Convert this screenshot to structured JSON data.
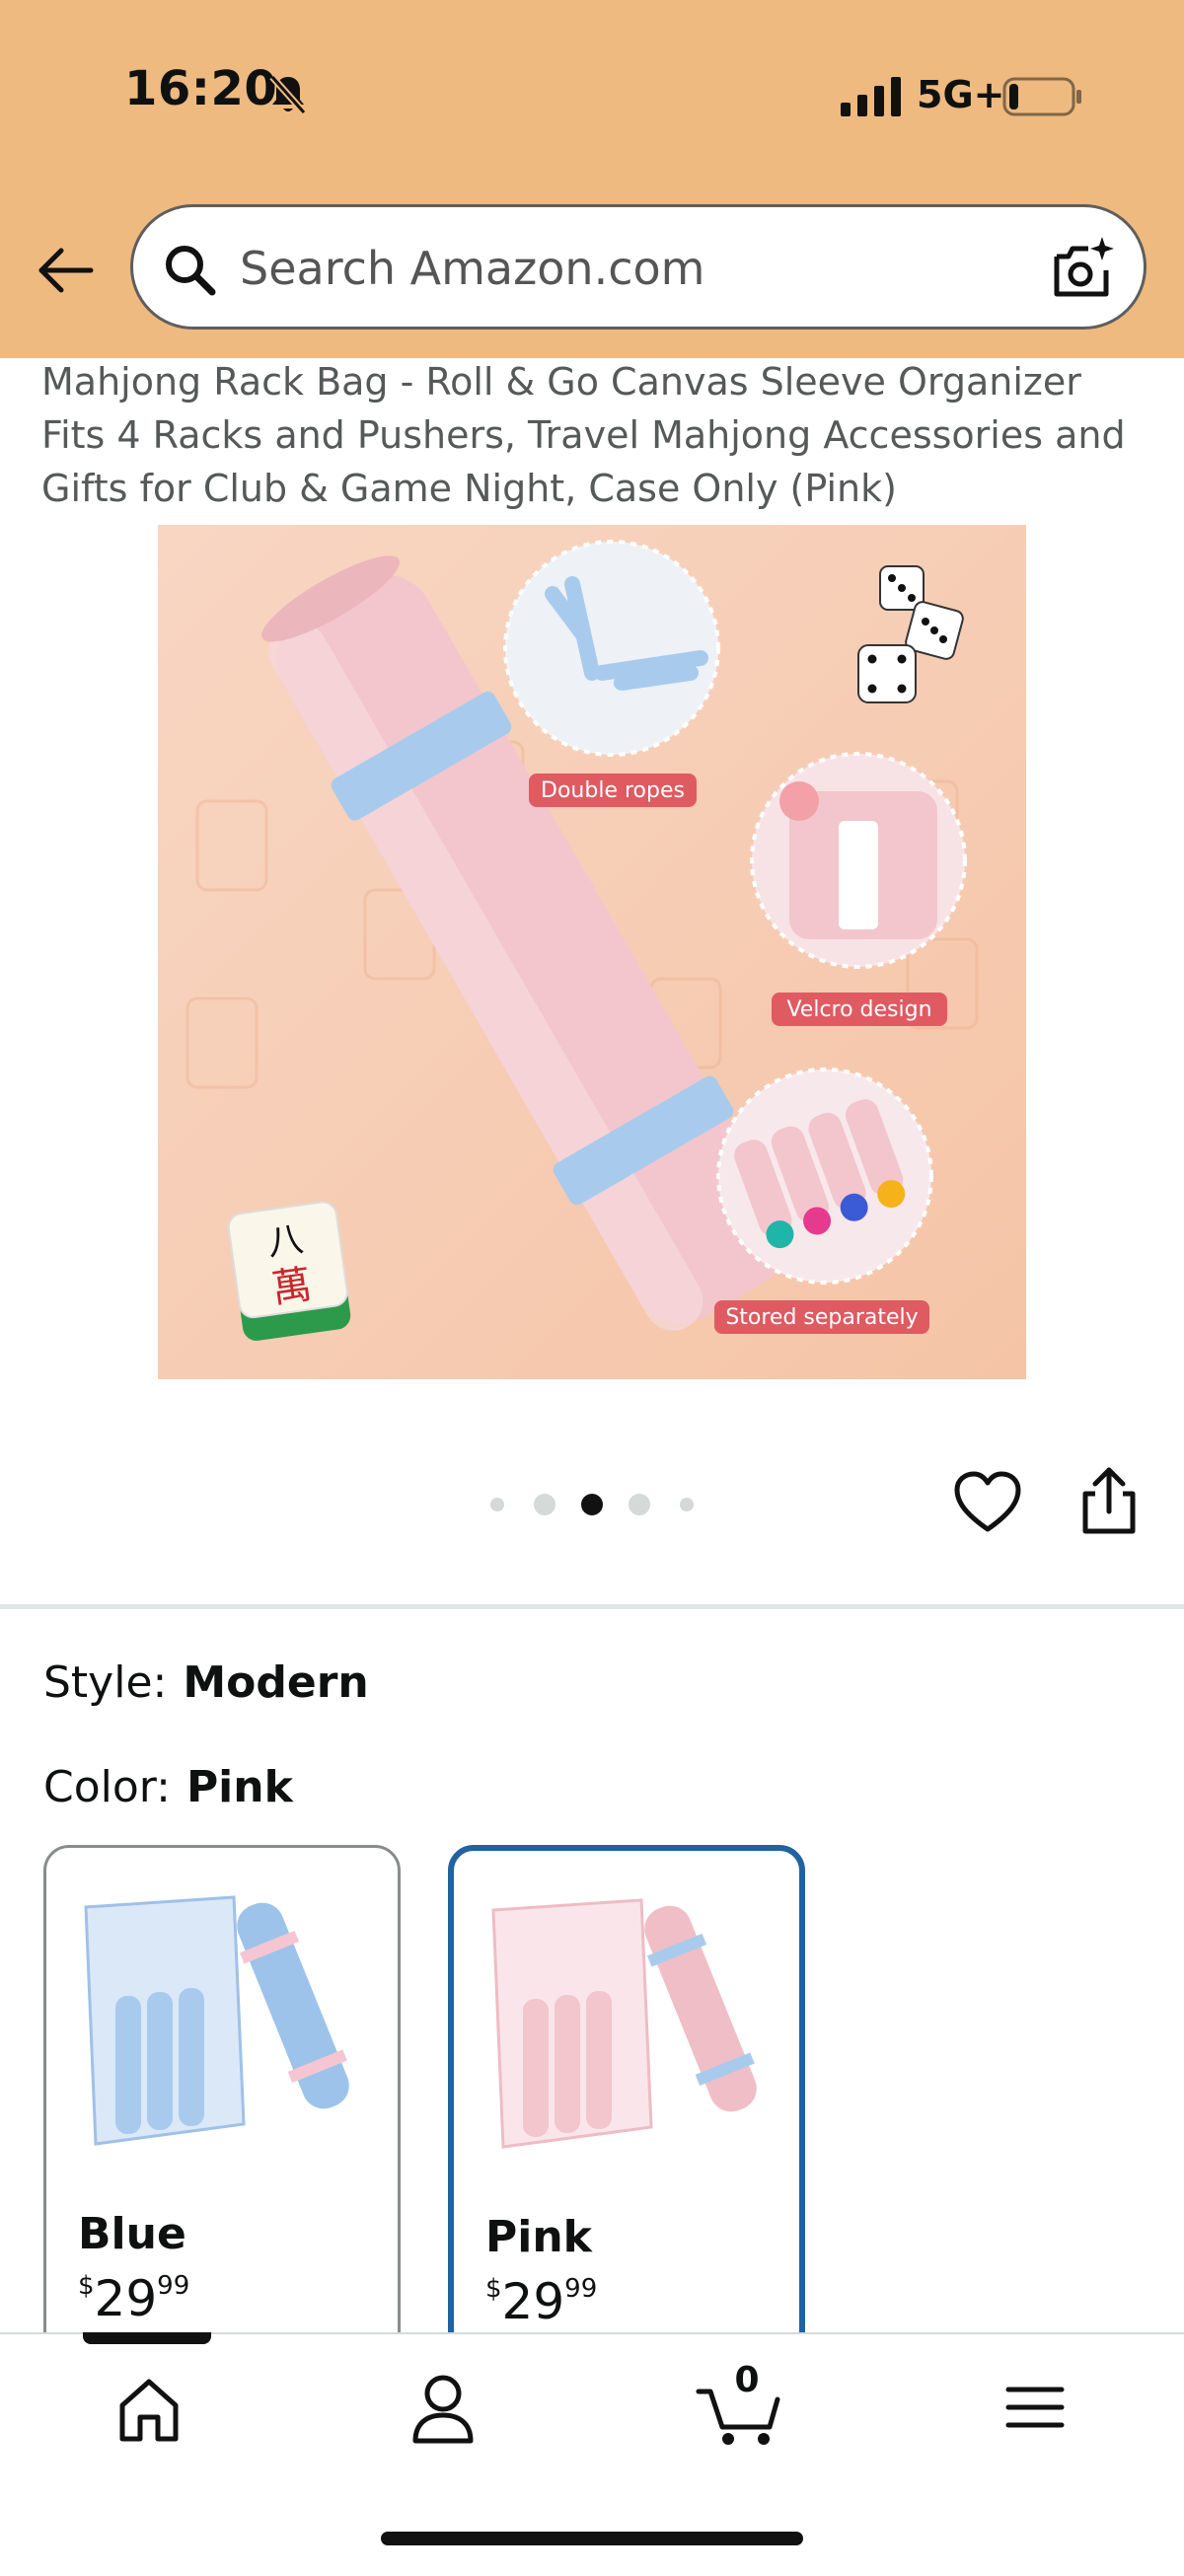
{
  "status_bar": {
    "time": "16:20",
    "network": "5G+",
    "battery_level": 0.15
  },
  "search": {
    "placeholder": "Search Amazon.com"
  },
  "product": {
    "title": "Mahjong Rack Bag - Roll & Go Canvas Sleeve Organizer Fits 4 Racks and Pushers, Travel Mahjong Accessories and Gifts for Club & Game Night, Case Only (Pink)",
    "image_callouts": [
      "Double ropes",
      "Velcro design",
      "Stored separately"
    ],
    "image_tile_glyphs": [
      "八",
      "萬"
    ],
    "carousel": {
      "total": 5,
      "active_index": 2
    }
  },
  "options": {
    "style_label": "Style:",
    "style_value": "Modern",
    "color_label": "Color:",
    "color_value": "Pink",
    "swatches": [
      {
        "name": "Blue",
        "currency": "$",
        "whole": "29",
        "cents": "99",
        "selected": false
      },
      {
        "name": "Pink",
        "currency": "$",
        "whole": "29",
        "cents": "99",
        "selected": true
      }
    ]
  },
  "bottom_nav": {
    "items": [
      "home-icon",
      "account-icon",
      "cart-icon",
      "menu-icon"
    ],
    "cart_count": "0",
    "active": "home-icon"
  },
  "colors": {
    "header_bg": "#eeba80",
    "selected_border": "#2162a1",
    "callout_red": "#e05a62",
    "product_pink": "#f2c6cc",
    "product_blue": "#a8cbed"
  }
}
